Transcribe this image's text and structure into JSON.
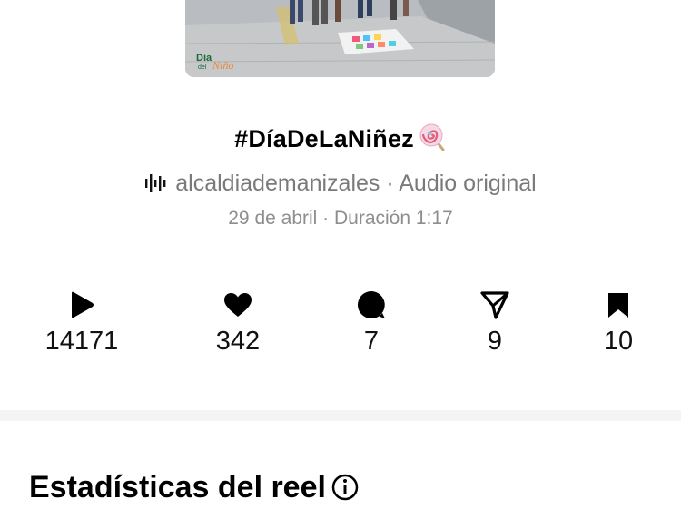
{
  "reel": {
    "thumbnail_logo_text_1": "Día",
    "thumbnail_logo_text_2": "del",
    "thumbnail_logo_text_3": "Niño",
    "title": "#DíaDeLaNiñez",
    "emoji_icon": "lollipop-icon",
    "audio": "alcaldiademanizales · Audio original",
    "audio_icon": "audio-wave-icon",
    "meta": "29 de abril · Duración 1:17"
  },
  "stats": [
    {
      "icon": "play-icon",
      "value": "14171"
    },
    {
      "icon": "heart-icon",
      "value": "342"
    },
    {
      "icon": "comment-icon",
      "value": "7"
    },
    {
      "icon": "send-icon",
      "value": "9"
    },
    {
      "icon": "bookmark-icon",
      "value": "10"
    }
  ],
  "section": {
    "title": "Estadísticas del reel"
  }
}
